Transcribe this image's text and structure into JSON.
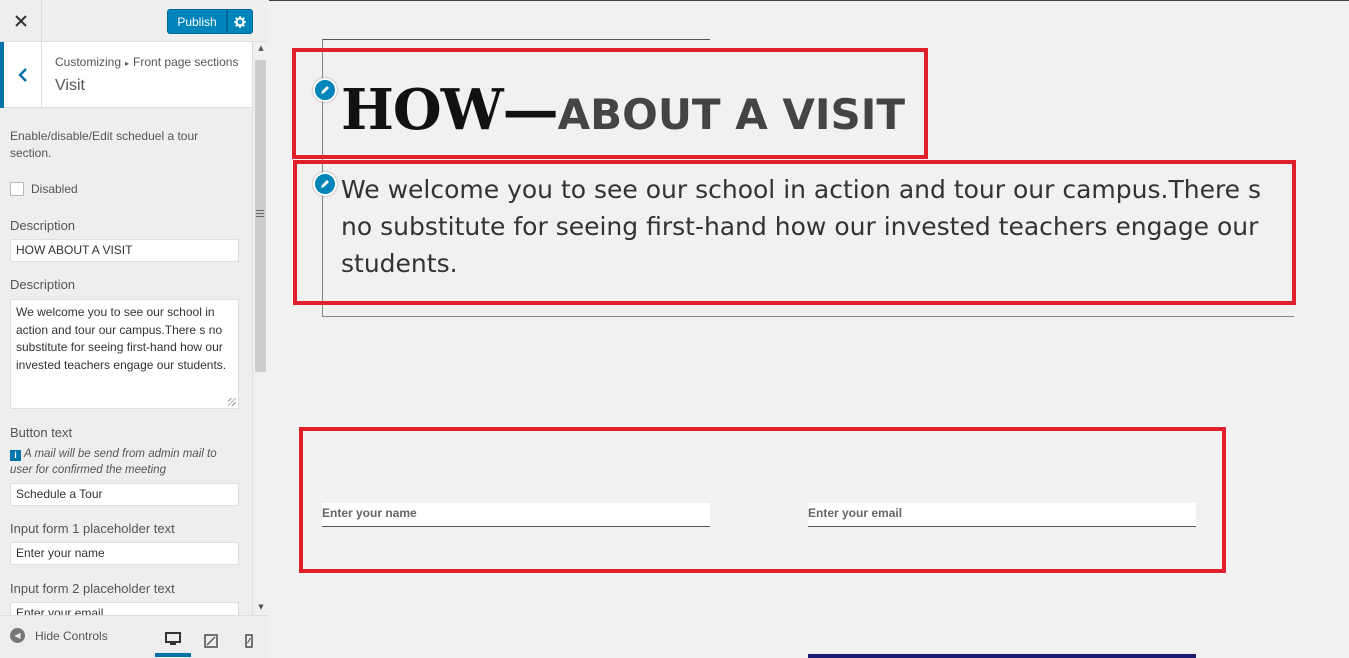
{
  "header": {
    "close_label": "✕",
    "publish_label": "Publish",
    "settings_icon": "gear-icon"
  },
  "panel": {
    "breadcrumb_root": "Customizing",
    "breadcrumb_sep": "▸",
    "breadcrumb_section": "Front page sections",
    "title": "Visit"
  },
  "controls": {
    "section_description": "Enable/disable/Edit scheduel a tour section.",
    "disabled_label": "Disabled",
    "disabled_checked": false,
    "title_label": "Description",
    "title_value": "HOW ABOUT A VISIT",
    "description_label": "Description",
    "description_value": "We welcome you to see our school in action and tour our campus.There s no substitute for seeing first-hand how our invested teachers engage our students.",
    "button_text_label": "Button text",
    "button_note": "A mail will be send from admin mail to user for confirmed the meeting",
    "button_text_value": "Schedule a Tour",
    "input1_label": "Input form 1 placeholder text",
    "input1_value": "Enter your name",
    "input2_label": "Input form 2 placeholder text",
    "input2_value": "Enter your email"
  },
  "footer": {
    "hide_controls_label": "Hide Controls"
  },
  "preview": {
    "heading_bold": "HOW—",
    "heading_rest": "ABOUT A VISIT",
    "intro_text": "We welcome you to see our school in action and tour our campus.There s no substitute for seeing first-hand how our invested teachers engage our students.",
    "name_placeholder": "Enter your name",
    "email_placeholder": "Enter your email"
  },
  "colors": {
    "accent": "#0085ba",
    "highlight_box": "#e0202b"
  }
}
